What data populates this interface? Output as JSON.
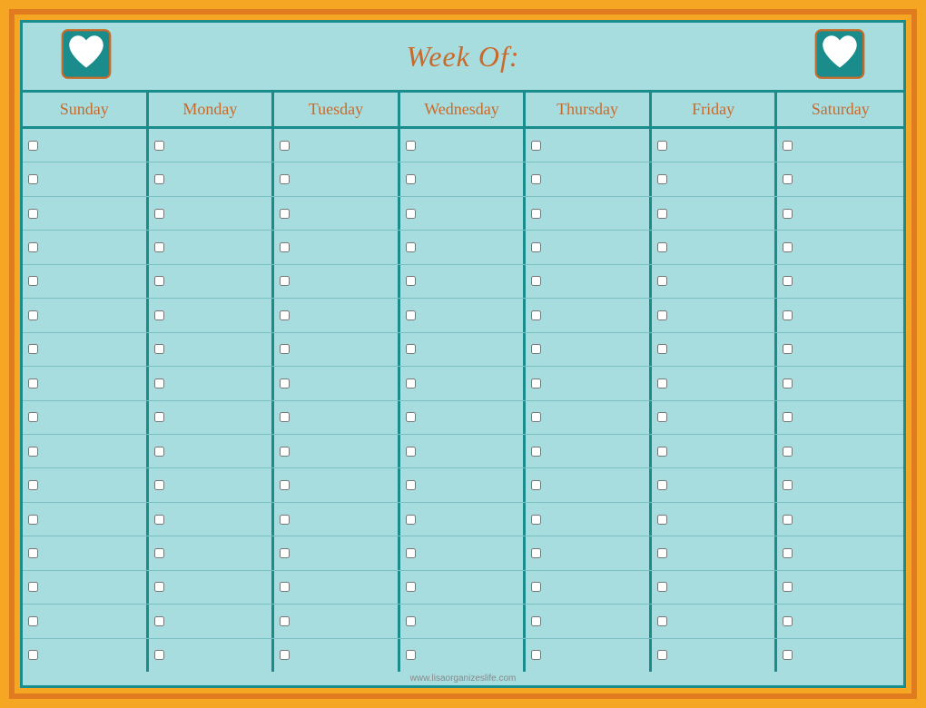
{
  "header": {
    "title": "Week Of:",
    "left_heart_alt": "heart-left",
    "right_heart_alt": "heart-right"
  },
  "days": [
    "Sunday",
    "Monday",
    "Tuesday",
    "Wednesday",
    "Thursday",
    "Friday",
    "Saturday"
  ],
  "rows": 16,
  "footer": "www.lisaorganizeslife.com",
  "colors": {
    "teal": "#1a8c8c",
    "light_blue": "#a8dde0",
    "orange": "#e07b20",
    "text_orange": "#c96a2a"
  }
}
